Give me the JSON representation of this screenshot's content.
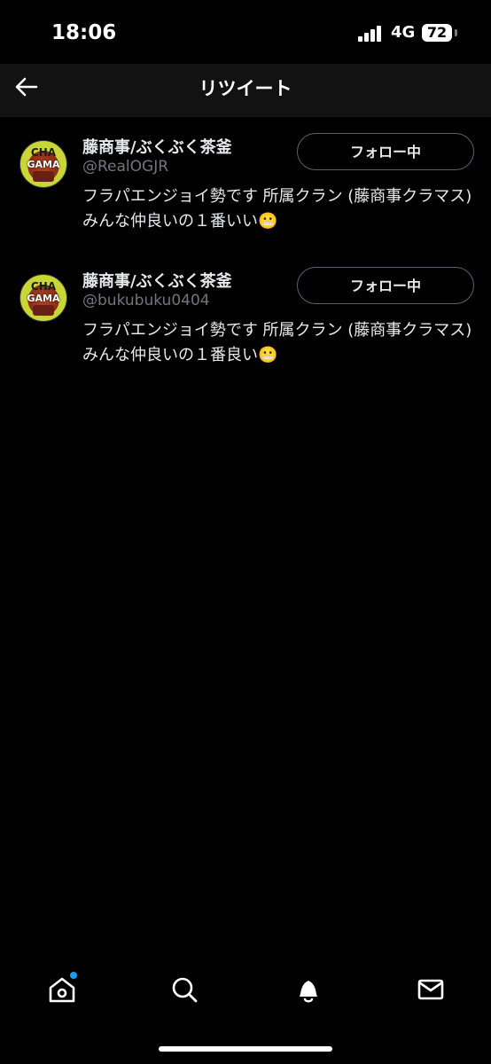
{
  "status_bar": {
    "time": "18:06",
    "network": "4G",
    "battery": "72"
  },
  "header": {
    "title": "リツイート",
    "back_icon": "arrow-left-icon"
  },
  "users": [
    {
      "name": "藤商事/ぶくぶく茶釜",
      "handle": "@RealOGJR",
      "follow_label": "フォロー中",
      "bio": "フラパエンジョイ勢です 所属クラン (藤商事クラマス) みんな仲良いの１番いい😬"
    },
    {
      "name": "藤商事/ぶくぶく茶釜",
      "handle": "@bukubuku0404",
      "follow_label": "フォロー中",
      "bio": "フラパエンジョイ勢です 所属クラン (藤商事クラマス) みんな仲良いの１番良い😬"
    }
  ],
  "avatar_text": {
    "line1": "CHA",
    "line2": "GAMA"
  },
  "bottom_nav": {
    "items": [
      "home-icon",
      "search-icon",
      "bell-icon",
      "mail-icon"
    ],
    "home_has_badge": true
  },
  "colors": {
    "background": "#000000",
    "follow_border": "#536471",
    "handle": "#71767b",
    "badge": "#1d9bf0"
  }
}
